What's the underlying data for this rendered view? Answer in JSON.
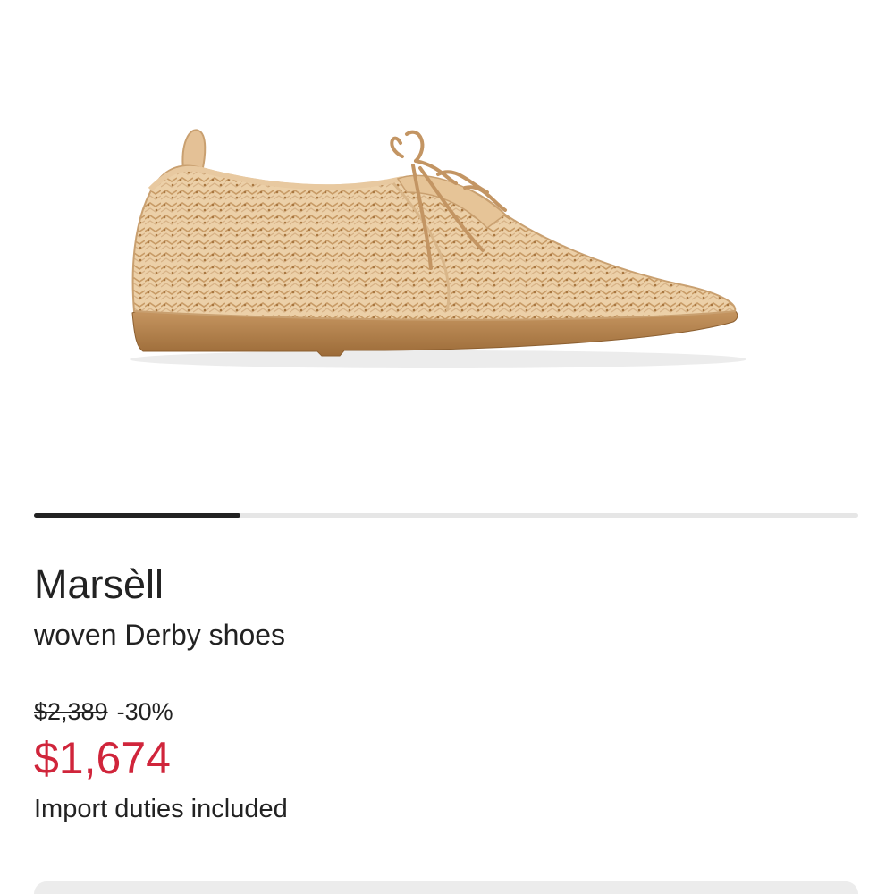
{
  "product": {
    "brand": "Marsèll",
    "name": "woven Derby shoes",
    "original_price": "$2,389",
    "discount": "-30%",
    "sale_price": "$1,674",
    "duties_note": "Import duties included"
  },
  "gallery": {
    "image_name": "product-image",
    "progress": 0.25
  },
  "colors": {
    "sale_price": "#d0253b",
    "text": "#222222",
    "track": "#e6e6e6",
    "shoe_leather": "#e8c9a0",
    "shoe_sole": "#b07c45"
  }
}
